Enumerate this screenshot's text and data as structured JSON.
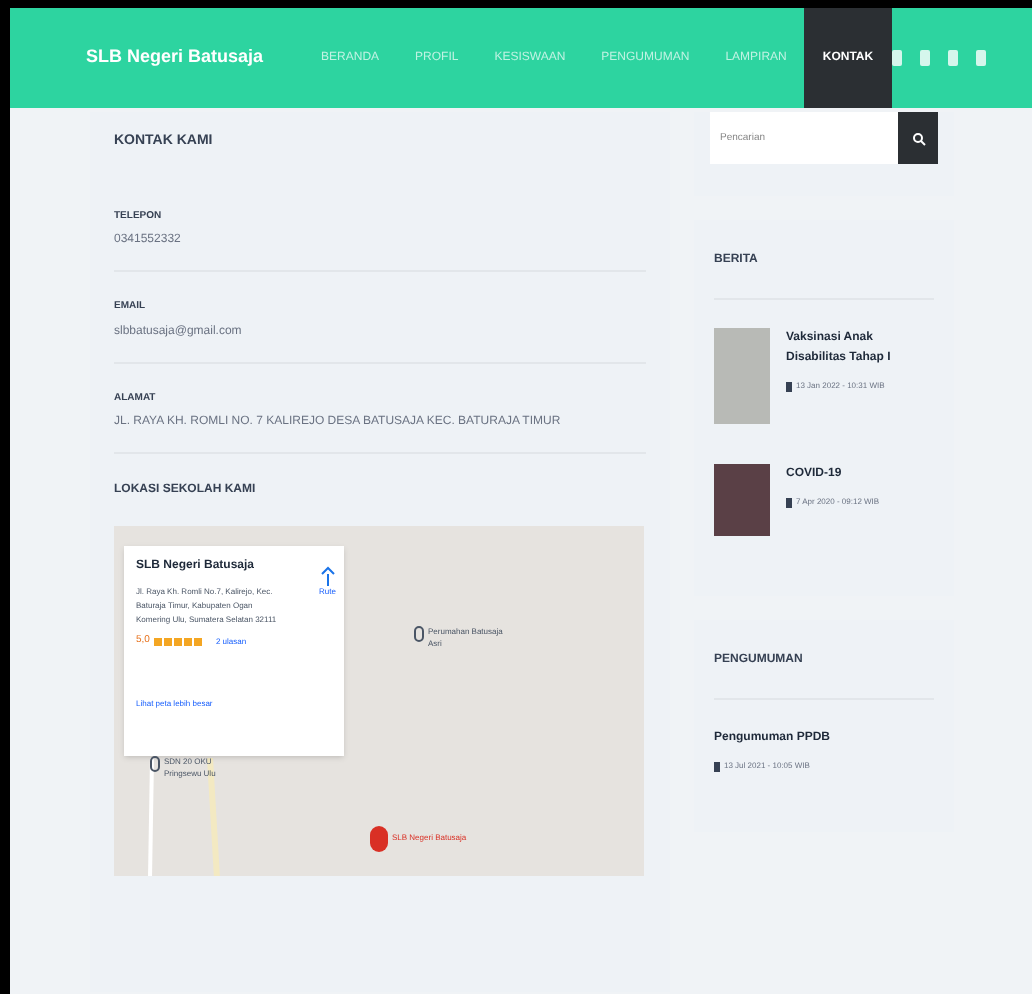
{
  "navbar": {
    "brand": "SLB Negeri Batusaja",
    "menu": [
      {
        "label": "BERANDA",
        "selected": false
      },
      {
        "label": "PROFIL",
        "selected": false
      },
      {
        "label": "KESISWAAN",
        "selected": false
      },
      {
        "label": "PENGUMUMAN",
        "selected": false
      },
      {
        "label": "LAMPIRAN",
        "selected": false
      },
      {
        "label": "KONTAK",
        "selected": true
      }
    ]
  },
  "contact": {
    "title": "KONTAK KAMI",
    "fields": [
      {
        "label": "TELEPON",
        "value": "0341552332"
      },
      {
        "label": "EMAIL",
        "value": "slbbatusaja@gmail.com"
      },
      {
        "label": "ALAMAT",
        "value": "JL. RAYA KH. ROMLI NO. 7 KALIREJO DESA BATUSAJA KEC. BATURAJA TIMUR"
      }
    ],
    "map_title": "LOKASI SEKOLAH KAMI",
    "map": {
      "card": {
        "name": "SLB Negeri Batusaja",
        "address": "Jl. Raya Kh. Romli No.7, Kalirejo, Kec. Baturaja Timur, Kabupaten Ogan Komering Ulu, Sumatera Selatan 32111",
        "rating": "5,0",
        "stars": 5,
        "reviews": "2 ulasan",
        "directions": "Rute",
        "larger_map": "Lihat peta lebih besar"
      },
      "places": [
        {
          "label": "Perumahan Batusaja Asri",
          "kind": "poi"
        },
        {
          "label": "SDN 20 OKU Pringsewu Ulu",
          "kind": "poi"
        },
        {
          "label": "SLB Negeri Batusaja",
          "kind": "target"
        }
      ]
    }
  },
  "sidebar": {
    "search": {
      "placeholder": "Pencarian"
    },
    "news": {
      "title": "BERITA",
      "items": [
        {
          "title": "Vaksinasi Anak Disabilitas Tahap I",
          "date": "13 Jan 2022 - 10:31 WIB"
        },
        {
          "title": "COVID-19",
          "date": "7 Apr 2020 - 09:12 WIB"
        }
      ]
    },
    "announcements": {
      "title": "PENGUMUMAN",
      "items": [
        {
          "title": "Pengumuman PPDB",
          "date": "13 Jul 2021 - 10:05 WIB"
        }
      ]
    }
  }
}
